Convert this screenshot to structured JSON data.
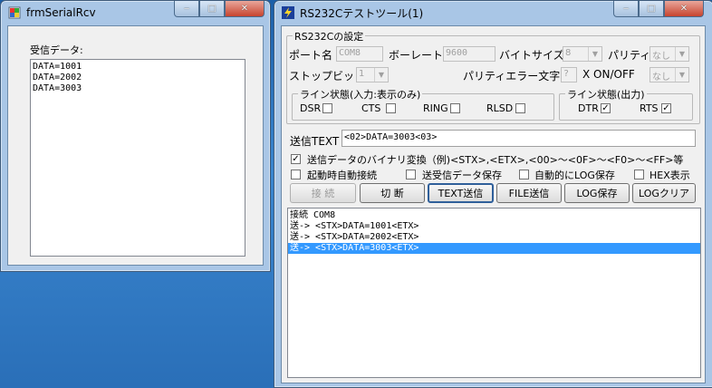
{
  "window1": {
    "title": "frmSerialRcv",
    "minimize": "‒",
    "maximize": "□",
    "close": "✕",
    "receive_label": "受信データ:",
    "received": [
      "DATA=1001",
      "DATA=2002",
      "DATA=3003"
    ]
  },
  "window2": {
    "title": "RS232Cテストツール(1)",
    "minimize": "‒",
    "maximize": "□",
    "close": "✕",
    "settings_group": "RS232Cの設定",
    "port_label": "ポート名",
    "port_value": "COM8",
    "baud_label": "ボーレート",
    "baud_value": "9600",
    "bytesize_label": "バイトサイズ",
    "bytesize_value": "8",
    "parity_label": "パリティ",
    "parity_value": "なし",
    "stopbit_label": "ストップビット",
    "stopbit_value": "1",
    "parity_error_label": "パリティエラー文字",
    "parity_error_value": "?",
    "xonoff_label": "X ON/OFF",
    "xonoff_value": "なし",
    "line_in_group": "ライン状態(入力:表示のみ)",
    "dsr": "DSR",
    "cts": "CTS",
    "ring": "RING",
    "rlsd": "RLSD",
    "line_out_group": "ライン状態(出力)",
    "dtr": "DTR",
    "rts": "RTS",
    "send_text_label": "送信TEXT",
    "send_text_value": "<02>DATA=3003<03>",
    "binary_convert_label": "送信データのバイナリ変換（例)<STX>,<ETX>,<00>～<0F>～<F0>～<FF>等",
    "auto_connect_label": "起動時自動接続",
    "save_send_recv_label": "送受信データ保存",
    "auto_log_label": "自動的にLOG保存",
    "hex_label": "HEX表示",
    "buttons": {
      "connect": "接 続",
      "disconnect": "切 断",
      "text_send": "TEXT送信",
      "file_send": "FILE送信",
      "log_save": "LOG保存",
      "log_clear": "LOGクリア"
    },
    "log": [
      "接続 COM8",
      "送-> <STX>DATA=1001<ETX>",
      "送-> <STX>DATA=2002<ETX>",
      "送-> <STX>DATA=3003<ETX>"
    ]
  },
  "colors": {
    "selection": "#3399ff",
    "window_frame": "#a9c6e6",
    "desktop": "#2a6fb8"
  }
}
